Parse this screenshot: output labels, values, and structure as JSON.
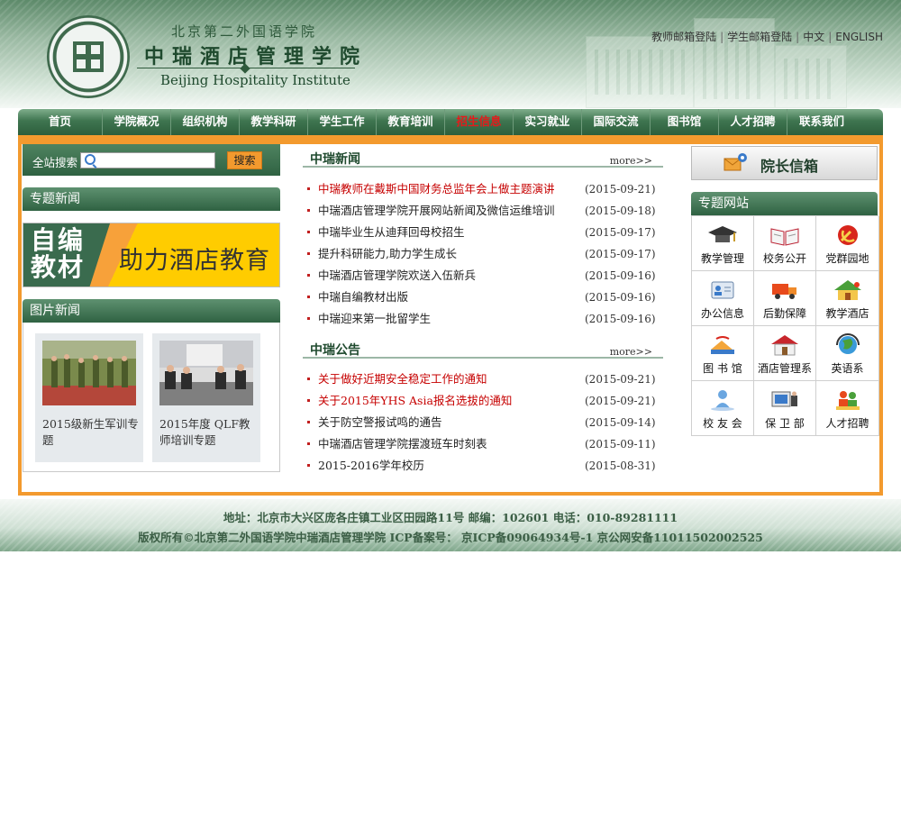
{
  "header": {
    "school_top": "北京第二外国语学院",
    "school_main": "中瑞酒店管理学院",
    "school_en": "Beijing Hospitality Institute",
    "links": [
      "教师邮箱登陆",
      "学生邮箱登陆",
      "中文",
      "ENGLISH"
    ]
  },
  "nav": {
    "items": [
      "首页",
      "学院概况",
      "组织机构",
      "教学科研",
      "学生工作",
      "教育培训",
      "招生信息",
      "实习就业",
      "国际交流",
      "图书馆",
      "人才招聘",
      "联系我们"
    ],
    "active": "招生信息"
  },
  "search": {
    "label": "全站搜索",
    "button": "搜索",
    "value": ""
  },
  "special_news": {
    "title": "专题新闻",
    "banner_big": "自编教材",
    "banner_text": "助力酒店教育"
  },
  "photo_news": {
    "title": "图片新闻",
    "items": [
      {
        "caption": "2015级新生军训专题"
      },
      {
        "caption": "2015年度 QLF教师培训专题"
      }
    ]
  },
  "news": {
    "title": "中瑞新闻",
    "more": "more>>",
    "items": [
      {
        "title": "中瑞教师在戴斯中国财务总监年会上做主题演讲",
        "date": "(2015-09-21)"
      },
      {
        "title": "中瑞酒店管理学院开展网站新闻及微信运维培训",
        "date": "(2015-09-18)"
      },
      {
        "title": "中瑞毕业生从迪拜回母校招生",
        "date": "(2015-09-17)"
      },
      {
        "title": "提升科研能力,助力学生成长",
        "date": "(2015-09-17)"
      },
      {
        "title": "中瑞酒店管理学院欢送入伍新兵",
        "date": "(2015-09-16)"
      },
      {
        "title": "中瑞自编教材出版",
        "date": "(2015-09-16)"
      },
      {
        "title": "中瑞迎来第一批留学生",
        "date": "(2015-09-16)"
      }
    ]
  },
  "notices": {
    "title": "中瑞公告",
    "more": "more>>",
    "items": [
      {
        "title": "关于做好近期安全稳定工作的通知",
        "date": "(2015-09-21)"
      },
      {
        "title": "关于2015年YHS Asia报名选拔的通知",
        "date": "(2015-09-21)"
      },
      {
        "title": "关于防空警报试鸣的通告",
        "date": "(2015-09-14)"
      },
      {
        "title": "中瑞酒店管理学院摆渡班车时刻表",
        "date": "(2015-09-11)"
      },
      {
        "title": "2015-2016学年校历",
        "date": "(2015-08-31)"
      }
    ]
  },
  "dean_mailbox": "院长信箱",
  "special_sites": {
    "title": "专题网站",
    "items": [
      {
        "label": "教学管理",
        "icon": "graduation-cap-icon"
      },
      {
        "label": "校务公开",
        "icon": "open-book-icon"
      },
      {
        "label": "党群园地",
        "icon": "party-emblem-icon"
      },
      {
        "label": "办公信息",
        "icon": "id-card-icon"
      },
      {
        "label": "后勤保障",
        "icon": "truck-icon"
      },
      {
        "label": "教学酒店",
        "icon": "hotel-house-icon"
      },
      {
        "label": "图 书 馆",
        "icon": "books-icon"
      },
      {
        "label": "酒店管理系",
        "icon": "house-icon"
      },
      {
        "label": "英语系",
        "icon": "globe-icon"
      },
      {
        "label": "校 友 会",
        "icon": "person-globe-icon"
      },
      {
        "label": "保 卫 部",
        "icon": "monitor-guard-icon"
      },
      {
        "label": "人才招聘",
        "icon": "people-icon"
      }
    ]
  },
  "footer": {
    "address": "地址：北京市大兴区庞各庄镇工业区田园路11号  邮编：102601 电话：010-89281111",
    "copyright": "版权所有©北京第二外国语学院中瑞酒店管理学院  ICP备案号：  京ICP备09064934号-1 京公网安备11011502002525"
  }
}
